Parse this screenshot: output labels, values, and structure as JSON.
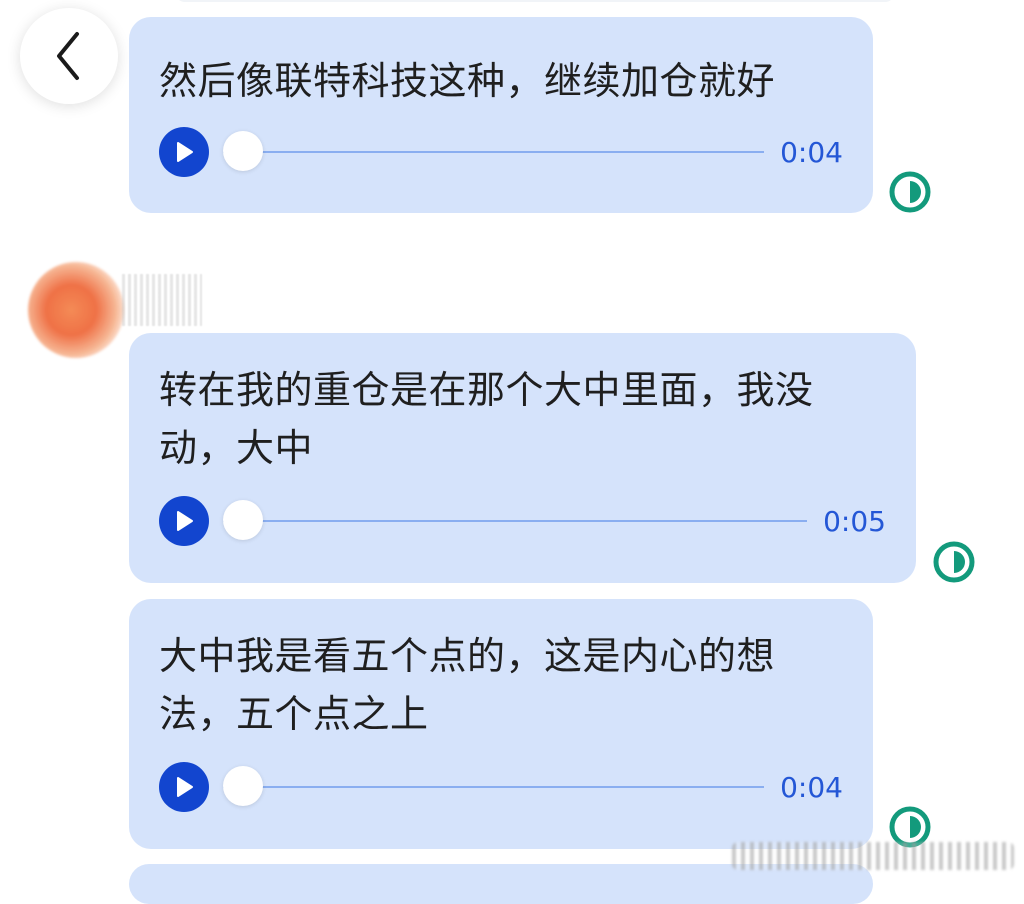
{
  "messages": [
    {
      "text": "然后像联特科技这种，继续加仓就好",
      "duration": "0:04",
      "progress": 0
    },
    {
      "text": "转在我的重仓是在那个大中里面，我没动，大中",
      "duration": "0:05",
      "progress": 0
    },
    {
      "text": "大中我是看五个点的，这是内心的想法，五个点之上",
      "duration": "0:04",
      "progress": 0
    }
  ],
  "icons": {
    "back": "chevron-left-icon",
    "play": "play-icon",
    "read_status": "half-circle-status-icon",
    "avatar": "avatar-image-blurred"
  },
  "colors": {
    "bubble": "#d5e3fb",
    "play_button": "#1245cf",
    "duration_text": "#2457d6",
    "status_icon": "#139a7c"
  }
}
